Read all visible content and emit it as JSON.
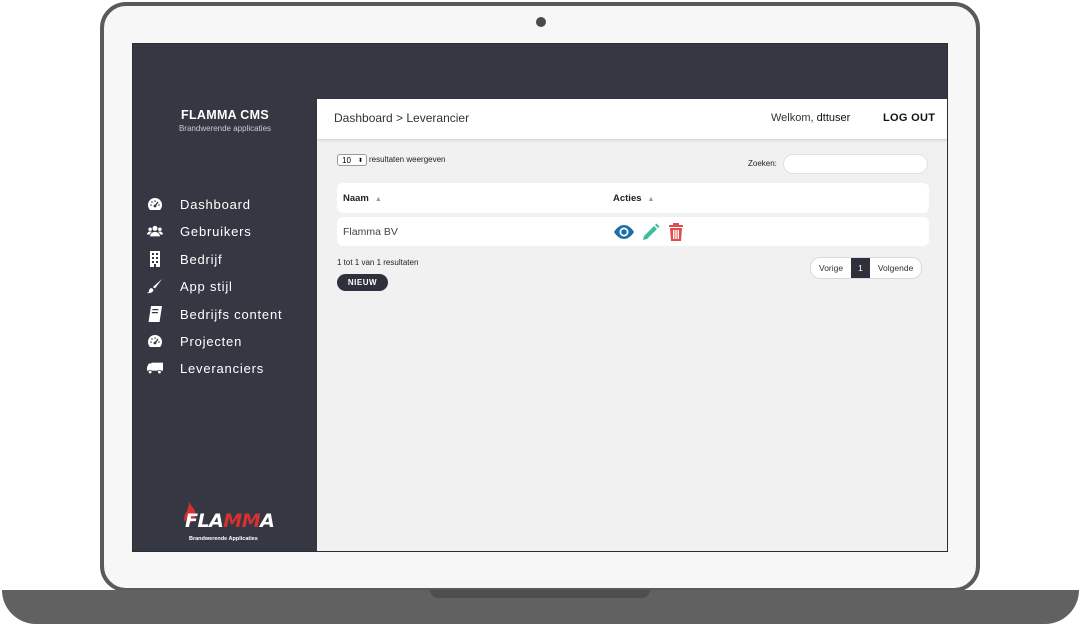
{
  "brand": {
    "title": "FLAMMA CMS",
    "subtitle": "Brandwerende applicaties"
  },
  "sidebar": {
    "items": [
      {
        "label": "Dashboard",
        "icon": "gauge-icon"
      },
      {
        "label": "Gebruikers",
        "icon": "users-icon"
      },
      {
        "label": "Bedrijf",
        "icon": "building-icon"
      },
      {
        "label": "App stijl",
        "icon": "paintbrush-icon"
      },
      {
        "label": "Bedrijfs content",
        "icon": "book-icon"
      },
      {
        "label": "Projecten",
        "icon": "gauge-icon"
      },
      {
        "label": "Leveranciers",
        "icon": "truck-icon"
      }
    ]
  },
  "logo": {
    "word_white_1": "FLA",
    "word_red": "MM",
    "word_white_2": "A",
    "tagline": "Brandwerende Applicaties"
  },
  "header": {
    "breadcrumb": "Dashboard > Leverancier",
    "welcome_prefix": "Welkom,",
    "username": "dttuser",
    "logout": "LOG OUT"
  },
  "table_controls": {
    "page_length": "10",
    "length_label": "resultaten weergeven",
    "search_label": "Zoeken:",
    "search_value": ""
  },
  "table": {
    "columns": [
      "Naam",
      "Acties"
    ],
    "rows": [
      {
        "naam": "Flamma BV",
        "actions": [
          "eye-icon",
          "pencil-icon",
          "trash-icon"
        ]
      }
    ]
  },
  "footer": {
    "info": "1 tot 1 van 1 resultaten",
    "new_button": "NIEUW"
  },
  "pagination": {
    "prev": "Vorige",
    "current": "1",
    "next": "Volgende"
  },
  "colors": {
    "sidebar": "#353843",
    "view": "#1f6fa8",
    "edit": "#3bbf9a",
    "delete": "#e14b4b",
    "logo_red": "#d63030"
  }
}
